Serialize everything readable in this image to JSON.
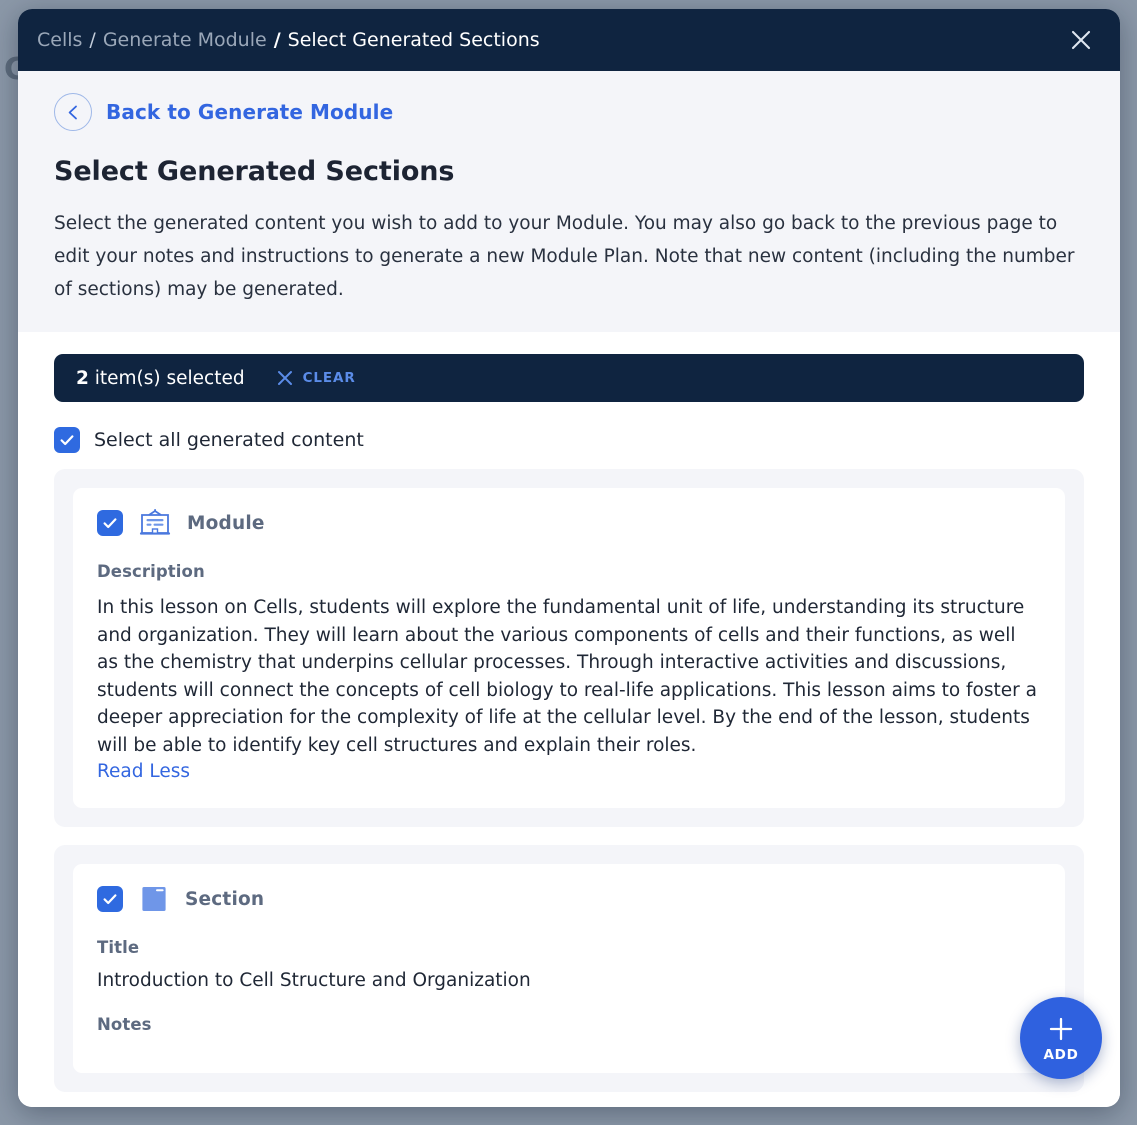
{
  "background": {
    "page_title_fragment": "C",
    "overlay_color": "#8b98a8"
  },
  "header": {
    "breadcrumb": {
      "root": "Cells",
      "parent": "Generate Module",
      "current": "Select Generated Sections",
      "separator": "/"
    },
    "close_icon": "close-icon",
    "bg_color": "#0f2440"
  },
  "intro": {
    "back_label": "Back to Generate Module",
    "back_icon": "chevron-left-icon",
    "title": "Select Generated Sections",
    "description": "Select the generated content you wish to add to your Module. You may also go back to the previous page to edit your notes and instructions to generate a new Module Plan. Note that new content (including the number of sections) may be generated."
  },
  "selection_bar": {
    "count": "2",
    "count_suffix": "item(s) selected",
    "clear_label": "CLEAR",
    "clear_icon": "close-icon",
    "accent_color": "#5b8ce8"
  },
  "select_all": {
    "label": "Select all generated content",
    "checked": true
  },
  "cards": [
    {
      "type_label": "Module",
      "icon": "module-board-icon",
      "checked": true,
      "fields": [
        {
          "label": "Description",
          "value": "In this lesson on Cells, students will explore the fundamental unit of life, understanding its structure and organization. They will learn about the various components of cells and their functions, as well as the chemistry that underpins cellular processes. Through interactive activities and discussions, students will connect the concepts of cell biology to real-life applications. This lesson aims to foster a deeper appreciation for the complexity of life at the cellular level. By the end of the lesson, students will be able to identify key cell structures and explain their roles."
        }
      ],
      "read_toggle": "Read Less"
    },
    {
      "type_label": "Section",
      "icon": "folder-icon",
      "checked": true,
      "fields": [
        {
          "label": "Title",
          "value": "Introduction to Cell Structure and Organization"
        },
        {
          "label": "Notes",
          "value": ""
        }
      ]
    }
  ],
  "fab": {
    "label": "ADD",
    "icon": "plus-icon",
    "color": "#2f61df"
  }
}
